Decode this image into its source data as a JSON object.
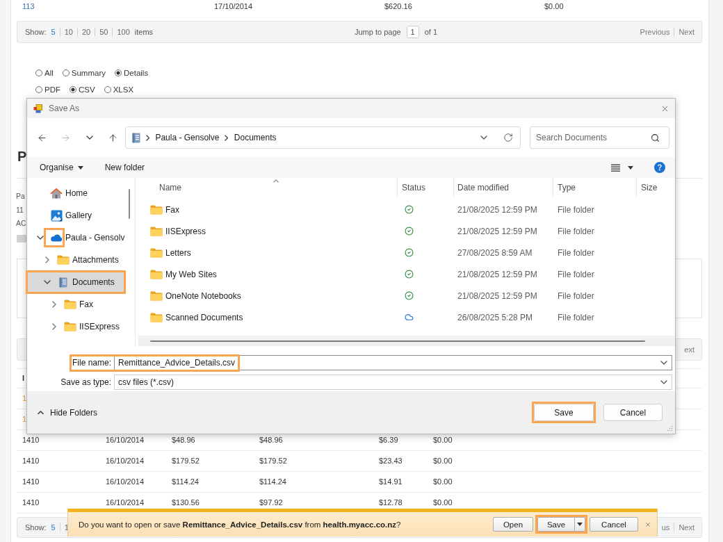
{
  "page": {
    "top_row": {
      "cells": [
        "113",
        "17/10/2014",
        "$620.16",
        "$0.00"
      ]
    },
    "pager_top": {
      "show_label": "Show:",
      "page_sizes": [
        {
          "label": "5",
          "selected": true
        },
        {
          "label": "10",
          "selected": false
        },
        {
          "label": "20",
          "selected": false
        },
        {
          "label": "50",
          "selected": false
        },
        {
          "label": "100",
          "selected": false
        }
      ],
      "items_label": "items",
      "jump_label": "Jump to page",
      "page_value": "1",
      "of_label": "of 1",
      "previous": "Previous",
      "next": "Next"
    },
    "scope_options": [
      {
        "label": "All",
        "selected": false
      },
      {
        "label": "Summary",
        "selected": false
      },
      {
        "label": "Details",
        "selected": true
      }
    ],
    "format_options": [
      {
        "label": "PDF",
        "selected": false
      },
      {
        "label": "CSV",
        "selected": true
      },
      {
        "label": "XLSX",
        "selected": false
      }
    ],
    "heading": "P",
    "detail_lines": [
      "Pa",
      "11",
      "AC"
    ],
    "pager_middle": {
      "next": "ext"
    },
    "table": {
      "header": "I",
      "rows": [
        {
          "highlighted": true,
          "cells": [
            "1"
          ]
        },
        {
          "highlighted": true,
          "cells": [
            "1"
          ]
        },
        {
          "highlighted": false,
          "cells": [
            "1410",
            "16/10/2014",
            "$48.96",
            "$48.96",
            "$6.39",
            "$0.00"
          ]
        },
        {
          "highlighted": false,
          "cells": [
            "1410",
            "16/10/2014",
            "$179.52",
            "$179.52",
            "$23.43",
            "$0.00"
          ]
        },
        {
          "highlighted": false,
          "cells": [
            "1410",
            "16/10/2014",
            "$114.24",
            "$114.24",
            "$14.91",
            "$0.00"
          ]
        },
        {
          "highlighted": false,
          "cells": [
            "1410",
            "16/10/2014",
            "$130.56",
            "$97.92",
            "$12.78",
            "$0.00"
          ]
        }
      ]
    },
    "pager_bottom": {
      "show_label": "Show:",
      "page_sizes": [
        {
          "label": "5",
          "selected": true
        },
        {
          "label": "1",
          "selected": false
        }
      ],
      "previous": "us",
      "next": "Next"
    }
  },
  "save_dialog": {
    "title": "Save As",
    "navigation": [
      {
        "kind": "back",
        "disabled": false
      },
      {
        "kind": "forward",
        "disabled": true
      },
      {
        "kind": "recent",
        "disabled": false
      },
      {
        "kind": "up",
        "disabled": false
      }
    ],
    "breadcrumb": [
      "Paula - Gensolve",
      "Documents"
    ],
    "search": {
      "placeholder": "Search Documents"
    },
    "toolbar": {
      "organise": "Organise",
      "new_folder": "New folder"
    },
    "nav_tree": [
      {
        "label": "Home",
        "kind": "home",
        "expandable": false,
        "selected": false,
        "highlighted": false,
        "icon_highlighted": false
      },
      {
        "label": "Gallery",
        "kind": "gallery",
        "expandable": false,
        "selected": false,
        "highlighted": false,
        "icon_highlighted": false
      },
      {
        "label": "Paula - Gensolv",
        "kind": "cloud_drive",
        "expandable": true,
        "expanded": true,
        "selected": false,
        "highlighted": false,
        "icon_highlighted": true,
        "children": [
          {
            "label": "Attachments",
            "kind": "folder",
            "expandable": true,
            "expanded": false,
            "selected": false,
            "highlighted": false,
            "icon_highlighted": false
          },
          {
            "label": "Documents",
            "kind": "library",
            "expandable": true,
            "expanded": true,
            "selected": true,
            "highlighted": true,
            "icon_highlighted": false,
            "children": [
              {
                "label": "Fax",
                "kind": "folder",
                "expandable": true,
                "expanded": false,
                "selected": false,
                "highlighted": false,
                "icon_highlighted": false
              },
              {
                "label": "IISExpress",
                "kind": "folder",
                "expandable": true,
                "expanded": false,
                "selected": false,
                "highlighted": false,
                "icon_highlighted": false
              }
            ]
          }
        ]
      }
    ],
    "columns": [
      {
        "label": "Name",
        "sorted": true
      },
      {
        "label": "Status",
        "sorted": false
      },
      {
        "label": "Date modified",
        "sorted": false
      },
      {
        "label": "Type",
        "sorted": false
      },
      {
        "label": "Size",
        "sorted": false
      }
    ],
    "files": [
      {
        "name": "Fax",
        "online_only": false,
        "date": "21/08/2025 12:59 PM",
        "type": "File folder"
      },
      {
        "name": "IISExpress",
        "online_only": false,
        "date": "21/08/2025 12:59 PM",
        "type": "File folder"
      },
      {
        "name": "Letters",
        "online_only": false,
        "date": "27/08/2025 8:59 AM",
        "type": "File folder"
      },
      {
        "name": "My Web Sites",
        "online_only": false,
        "date": "21/08/2025 12:59 PM",
        "type": "File folder"
      },
      {
        "name": "OneNote Notebooks",
        "online_only": false,
        "date": "21/08/2025 12:59 PM",
        "type": "File folder"
      },
      {
        "name": "Scanned Documents",
        "online_only": true,
        "date": "26/08/2025 5:28 PM",
        "type": "File folder"
      }
    ],
    "file_name": {
      "label": "File name:",
      "value": "Remittance_Advice_Details.csv",
      "highlighted": true
    },
    "save_type": {
      "label": "Save as type:",
      "value": "csv files (*.csv)"
    },
    "hide_folders": "Hide Folders",
    "buttons": [
      {
        "label": "Save",
        "highlighted": true
      },
      {
        "label": "Cancel",
        "highlighted": false
      }
    ]
  },
  "download_bar": {
    "message": "Do you want to open or save **Remittance_Advice_Details.csv** from **health.myacc.co.nz**?",
    "buttons": [
      {
        "label": "Open",
        "kind": "plain",
        "highlighted": false
      },
      {
        "label": "Save",
        "kind": "split",
        "highlighted": true
      },
      {
        "label": "Cancel",
        "kind": "plain",
        "highlighted": false
      }
    ]
  }
}
